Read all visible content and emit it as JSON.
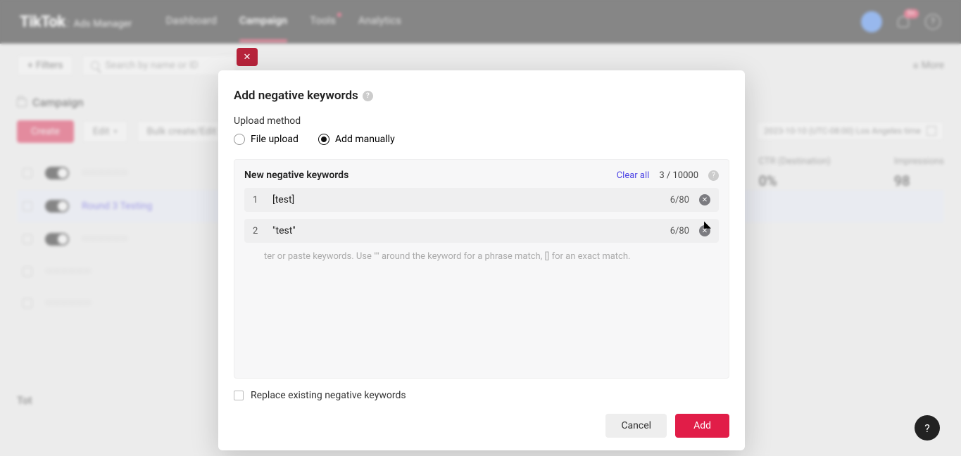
{
  "brand": {
    "logo": "TikTok",
    "sub": "Ads Manager"
  },
  "nav": {
    "items": [
      {
        "label": "Dashboard"
      },
      {
        "label": "Campaign"
      },
      {
        "label": "Tools"
      },
      {
        "label": "Analytics"
      }
    ],
    "badge": "9+"
  },
  "toolbar": {
    "filters": "Filters",
    "search_placeholder": "Search by name or ID",
    "more": "More"
  },
  "campaign_header": "Campaign",
  "actions": {
    "create": "Create",
    "edit": "Edit",
    "bulk": "Bulk create/Edit"
  },
  "rows": {
    "highlighted": "Round 3 Testing"
  },
  "date_range": "2023-10-10  (UTC-08:00) Los Angeles time",
  "metrics": [
    {
      "title": "CTR (Destination)",
      "value": "0%"
    },
    {
      "title": "Impressions",
      "value": "98"
    }
  ],
  "total_label": "Tot",
  "modal": {
    "title": "Add negative keywords",
    "upload_method_label": "Upload method",
    "file_upload": "File upload",
    "add_manually": "Add manually",
    "panel_title": "New negative keywords",
    "clear_all": "Clear all",
    "count": "3 / 10000",
    "keywords": [
      {
        "n": "1",
        "text": "[test]",
        "len": "6/80"
      },
      {
        "n": "2",
        "text": "\"test\"",
        "len": "6/80"
      }
    ],
    "hint": "ter or paste keywords. Use \"\" around the keyword for a phrase match, [] for an exact match.",
    "replace_label": "Replace existing negative keywords",
    "cancel": "Cancel",
    "add": "Add"
  }
}
